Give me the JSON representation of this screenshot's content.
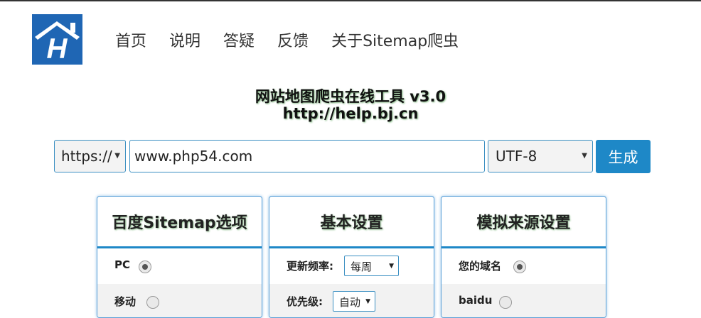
{
  "nav": [
    "首页",
    "说明",
    "答疑",
    "反馈",
    "关于Sitemap爬虫"
  ],
  "header": {
    "title": "网站地图爬虫在线工具 v3.0",
    "subtitle": "http://help.bj.cn"
  },
  "form": {
    "protocol": "https://",
    "url": "www.php54.com",
    "encoding": "UTF-8",
    "generate_label": "生成"
  },
  "panels": {
    "baidu": {
      "title": "百度Sitemap选项",
      "options": [
        {
          "label": "PC",
          "selected": true
        },
        {
          "label": "移动",
          "selected": false
        }
      ]
    },
    "basic": {
      "title": "基本设置",
      "freq_label": "更新频率:",
      "freq_value": "每周",
      "priority_label": "优先级:",
      "priority_value": "自动"
    },
    "source": {
      "title": "模拟来源设置",
      "options": [
        {
          "label": "您的域名",
          "selected": true
        },
        {
          "label": "baidu",
          "selected": false
        }
      ]
    }
  },
  "colors": {
    "accent": "#1e88c7",
    "logo": "#1f66b4"
  }
}
